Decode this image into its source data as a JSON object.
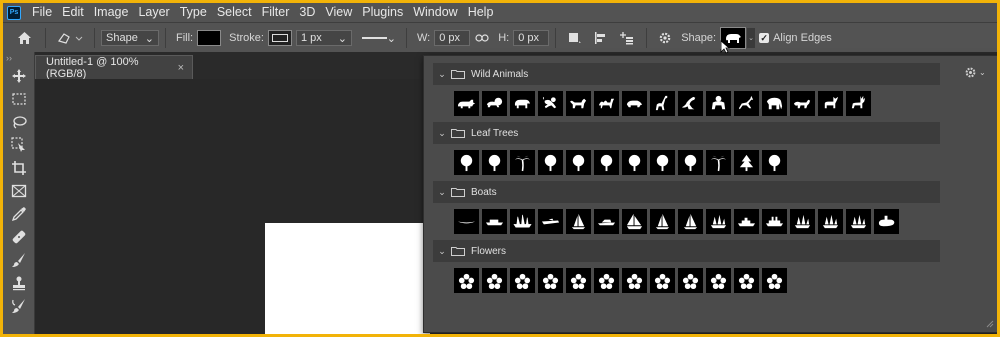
{
  "app": {
    "logo": "Ps"
  },
  "menu": [
    "File",
    "Edit",
    "Image",
    "Layer",
    "Type",
    "Select",
    "Filter",
    "3D",
    "View",
    "Plugins",
    "Window",
    "Help"
  ],
  "options": {
    "mode": "Shape",
    "fill_label": "Fill:",
    "stroke_label": "Stroke:",
    "stroke_width": "1 px",
    "w_label": "W:",
    "w_value": "0 px",
    "h_label": "H:",
    "h_value": "0 px",
    "shape_label": "Shape:",
    "align_edges_label": "Align Edges",
    "align_edges_checked": true
  },
  "document": {
    "tab_title": "Untitled-1 @ 100% (RGB/8)",
    "close": "×"
  },
  "tools": [
    "move-icon",
    "marquee-icon",
    "lasso-icon",
    "object-select-icon",
    "crop-icon",
    "frame-icon",
    "eyedropper-icon",
    "healing-icon",
    "brush-icon",
    "stamp-icon",
    "history-brush-icon"
  ],
  "shape_groups": [
    {
      "name": "Wild Animals",
      "count": 15,
      "icons": [
        "rhino",
        "lion",
        "bear",
        "monkey",
        "wolf",
        "camel",
        "boar",
        "giraffe",
        "kangaroo",
        "gorilla",
        "gazelle",
        "elephant",
        "fox",
        "moose",
        "deer"
      ]
    },
    {
      "name": "Leaf Trees",
      "count": 12,
      "icons": [
        "tree",
        "tree",
        "palm",
        "tree",
        "tree",
        "tree",
        "tree",
        "tree",
        "tree",
        "palm",
        "pine",
        "tree"
      ]
    },
    {
      "name": "Boats",
      "count": 16,
      "icons": [
        "canoe",
        "barge",
        "ship",
        "speedboat",
        "sail",
        "yacht",
        "sailboat",
        "sail",
        "sail",
        "sailship",
        "cruiser",
        "steamship",
        "sailship",
        "sailship",
        "sailship",
        "submarine"
      ]
    },
    {
      "name": "Flowers",
      "count": 12,
      "icons": [
        "flower",
        "flower",
        "flower",
        "flower",
        "flower",
        "flower",
        "flower",
        "flower",
        "flower",
        "flower",
        "flower",
        "flower"
      ]
    }
  ],
  "colors": {
    "accent": "#f2b308",
    "panel": "#535353",
    "popup": "#4b4b4b",
    "shape_bg": "#000000"
  }
}
